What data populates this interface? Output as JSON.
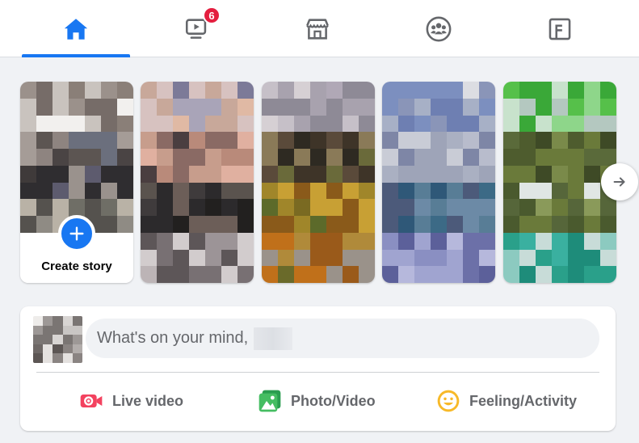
{
  "nav": {
    "tabs": [
      {
        "name": "home",
        "icon": "home-icon",
        "active": true
      },
      {
        "name": "watch",
        "icon": "video-icon",
        "badge": "6"
      },
      {
        "name": "marketplace",
        "icon": "store-icon"
      },
      {
        "name": "groups",
        "icon": "groups-icon"
      },
      {
        "name": "gaming",
        "icon": "gaming-icon"
      }
    ]
  },
  "stories": {
    "create_label": "Create story"
  },
  "composer": {
    "placeholder": "What's on your mind,",
    "actions": [
      {
        "label": "Live video",
        "icon": "live-video-icon",
        "color": "#f3425f"
      },
      {
        "label": "Photo/Video",
        "icon": "photo-icon",
        "color": "#45bd62"
      },
      {
        "label": "Feeling/Activity",
        "icon": "feeling-icon",
        "color": "#f7b928"
      }
    ]
  },
  "colors": {
    "accent": "#1877f2",
    "badge": "#e41e3f",
    "background": "#f0f2f5"
  }
}
